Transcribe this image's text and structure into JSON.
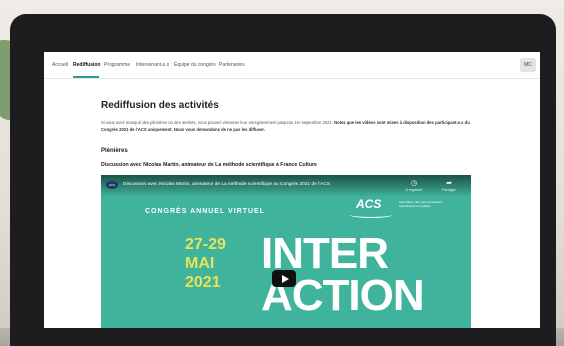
{
  "nav": {
    "items": [
      {
        "label": "Accueil",
        "active": false
      },
      {
        "label": "Rediffusion",
        "active": true
      },
      {
        "label": "Programme",
        "active": false
      },
      {
        "label": "Intervenant.e.s",
        "active": false
      },
      {
        "label": "Équipe du congrès",
        "active": false
      },
      {
        "label": "Partenaires",
        "active": false
      }
    ],
    "avatar": "MC",
    "accent": "#2c9d8e"
  },
  "page": {
    "title": "Rediffusion des activités",
    "intro": "Si vous avez manqué des plénières ou des ateliers, vous pouvez visionner leur enregistrement jusqu'au 1er septembre 2021.",
    "intro_bold": "Notez que les vidéos sont mises à disposition des participant.e.s du Congrès 2021 de l'ACS uniquement. Nous vous demandons de ne pas les diffuser.",
    "section": "Plénières",
    "talk": "Discussion avec Nicolas Martin, animateur de La méthode scientifique à France Culture"
  },
  "video": {
    "title": "Discussion avec Nicolas Martin, animateur de La méthode scientifique au Congrès 2021 de l'ACS",
    "logo": "ACS",
    "watch_later": "À regarder",
    "share": "Partager",
    "banner": "CONGRÈS ANNUEL VIRTUEL",
    "org": "ACS",
    "org_sub": "association des communicateurs scientifiques du Québec",
    "dates": [
      "27-29",
      "MAI",
      "2021"
    ],
    "big": [
      "INTER",
      "ACTION"
    ],
    "bg_color": "#3fb39c",
    "date_color": "#e9e35a"
  }
}
